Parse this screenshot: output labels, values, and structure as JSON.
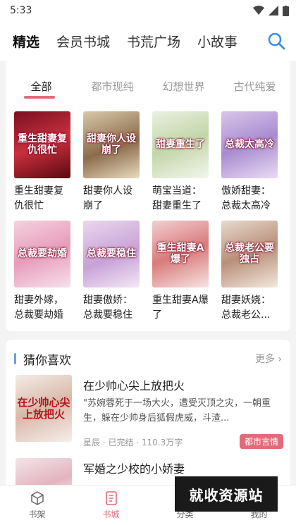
{
  "status": {
    "time": "5:33"
  },
  "topnav": {
    "tabs": [
      "精选",
      "会员书城",
      "书荒广场",
      "小故事"
    ],
    "active": 0
  },
  "section1": {
    "subtabs": [
      "全部",
      "都市现纯",
      "幻想世界",
      "古代纯爱"
    ],
    "active": 0,
    "books": [
      {
        "title": "重生甜妻复仇很忙",
        "cover_text": "重生甜妻复仇很忙"
      },
      {
        "title": "甜妻你人设崩了",
        "cover_text": "甜妻你人设崩了"
      },
      {
        "title": "萌宝当道：甜妻重生了",
        "cover_text": "甜妻重生了"
      },
      {
        "title": "傲娇甜妻：总裁太高冷",
        "cover_text": "总裁太高冷"
      },
      {
        "title": "甜妻外嫁，总裁要劫婚",
        "cover_text": "总裁要劫婚"
      },
      {
        "title": "甜妻傲娇：总裁要稳住",
        "cover_text": "总裁要稳住"
      },
      {
        "title": "重生甜妻A爆了",
        "cover_text": "重生甜妻A爆了"
      },
      {
        "title": "甜妻妖娆：总裁老公...",
        "cover_text": "总裁老公要独占"
      }
    ]
  },
  "section2": {
    "title": "猜你喜欢",
    "more": "更多 ›",
    "items": [
      {
        "title": "在少帅心尖上放把火",
        "cover_text": "在少帅心尖上放把火",
        "desc": "\"苏婉蓉死于一场大火，遭受灭顶之灾，一朝重生，躲在少帅身后狐假虎威，斗渣...",
        "meta": "星辰 · 已完结 · 110.3万字",
        "tag": "都市言情"
      },
      {
        "title": "军婚之少校的小娇妻"
      }
    ]
  },
  "bottomnav": {
    "items": [
      "书架",
      "书城",
      "分类",
      "我的"
    ],
    "active": 1
  },
  "watermark": "就收资源站",
  "colors": {
    "accent": "#e46a7a",
    "section_bar": "#6aa0e0"
  }
}
